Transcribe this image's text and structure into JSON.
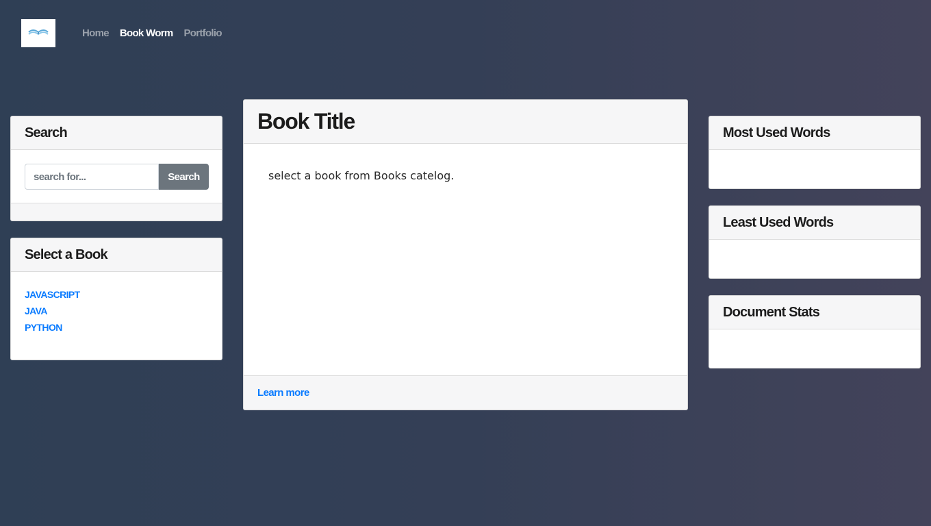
{
  "navbar": {
    "logo_icon": "open-book-icon",
    "links": [
      {
        "label": "Home",
        "active": false
      },
      {
        "label": "Book Worm",
        "active": true
      },
      {
        "label": "Portfolio",
        "active": false
      }
    ]
  },
  "search": {
    "title": "Search",
    "placeholder": "search for...",
    "value": "",
    "button_label": "Search"
  },
  "books": {
    "title": "Select a Book",
    "items": [
      "JAVASCRIPT",
      "JAVA",
      "PYTHON"
    ]
  },
  "main": {
    "title": "Book Title",
    "body_text": "select a book from Books catelog.",
    "footer_link": "Learn more"
  },
  "most_used": {
    "title": "Most Used Words"
  },
  "least_used": {
    "title": "Least Used Words"
  },
  "stats": {
    "title": "Document Stats"
  },
  "colors": {
    "link": "#0a7bff",
    "button": "#6c757d",
    "background_left": "#2f3f55",
    "background_right": "#43435a"
  }
}
